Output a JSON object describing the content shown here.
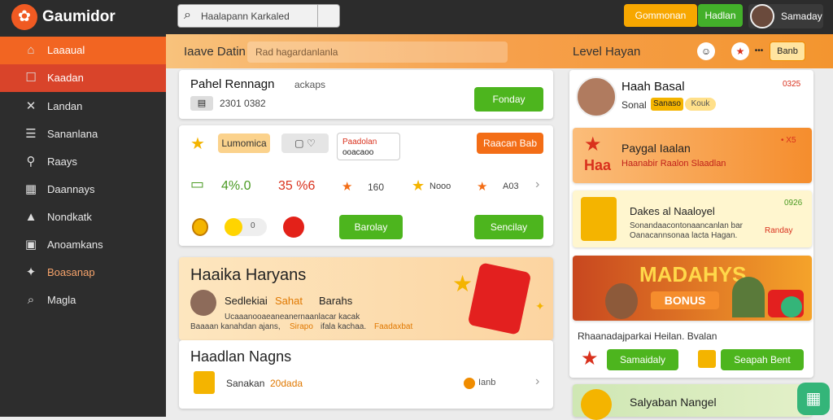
{
  "topbar": {
    "brand": "Gaumidor",
    "search_placeholder": "Haalapann Karkaled",
    "btn_orange": "Gommonan",
    "btn_green": "Hadlan",
    "user": "Samaday"
  },
  "sidebar": {
    "items": [
      {
        "label": "Laaaual",
        "icon": "home-icon"
      },
      {
        "label": "Kaadan",
        "icon": "inbox-icon"
      },
      {
        "label": "Landan",
        "icon": "tools-icon"
      },
      {
        "label": "Sananlana",
        "icon": "list-icon"
      },
      {
        "label": "Raays",
        "icon": "pin-icon"
      },
      {
        "label": "Daannays",
        "icon": "calendar-icon"
      },
      {
        "label": "Nondkatk",
        "icon": "bag-icon"
      },
      {
        "label": "Anoamkans",
        "icon": "chart-icon"
      },
      {
        "label": "Boasanap",
        "icon": "puzzle-icon"
      },
      {
        "label": "Magla",
        "icon": "search-icon"
      }
    ]
  },
  "main": {
    "title": "Iaave Datin",
    "search": "Rad hagardanlanla"
  },
  "card1": {
    "title": "Pahel Rennagn",
    "subtitle": "ackaps",
    "meta": "2301 0382",
    "button": "Fonday"
  },
  "card2": {
    "tag_yellow": "Lumomica",
    "tag_red": "Paadolan",
    "tag_red2": "ooacaoo",
    "button_orange": "Raacan Bab",
    "stats": [
      {
        "value": "4%.0",
        "color": "#4a9a22"
      },
      {
        "value": "35 %6",
        "color": "#d9311d"
      },
      {
        "value": "160"
      },
      {
        "value": "Nooo"
      },
      {
        "value": "A03"
      }
    ],
    "buttons": [
      "Barolay",
      "Sencilay"
    ]
  },
  "banner": {
    "title": "Haaika Haryans",
    "user": "Sedlekiai",
    "label_a": "Sahat",
    "label_b": "Barahs",
    "line1": "Ucaaanooaeaneanernaanlacar kacak",
    "line2_a": "Baaaan kanahdan ajans,",
    "line2_b": "Sirapo",
    "line2_c": "ifala kachaa.",
    "line2_d": "Faadaxbat"
  },
  "card4": {
    "title": "Haadlan Nagns",
    "item": "Sanakan",
    "value": "20dada",
    "amount": "Ianb"
  },
  "right": {
    "title": "Level Hayan",
    "btn": "Banb",
    "profile": {
      "name": "Haah Basal",
      "number": "0325",
      "line": "Sonal",
      "badge1": "Sanaso",
      "badge2": "Kouk"
    },
    "promo1": {
      "title": "Paygal Iaalan",
      "red": "Haa",
      "sub": "Haanabir Raalon Slaadlan",
      "close": "• X5"
    },
    "promo2": {
      "title": "Dakes al Naaloyel",
      "num": "0926",
      "l1": "Sonandaacontonaancanlan bar",
      "l2": "Oanacannsonaa lacta Hagan.",
      "l3": "Randay"
    },
    "promo3": {
      "headline": "MADAHYS",
      "bonus": "BONUS"
    },
    "promo3_caption": "Rhaanadajparkai Heilan. Bvalan",
    "promo3_buttons": [
      "Samaidaly",
      "Seapah Bent"
    ],
    "promo4": {
      "title": "Salyaban Nangel"
    }
  }
}
